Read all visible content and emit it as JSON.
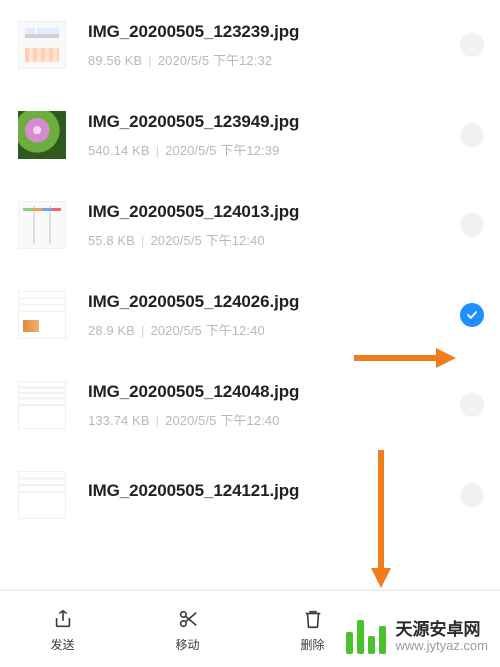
{
  "files": [
    {
      "name": "IMG_20200505_123239.jpg",
      "size": "89.56 KB",
      "date": "2020/5/5 下午12:32",
      "thumb": "screenshot",
      "selected": false
    },
    {
      "name": "IMG_20200505_123949.jpg",
      "size": "540.14 KB",
      "date": "2020/5/5 下午12:39",
      "thumb": "photo",
      "selected": false
    },
    {
      "name": "IMG_20200505_124013.jpg",
      "size": "55.8 KB",
      "date": "2020/5/5 下午12:40",
      "thumb": "diagram",
      "selected": false
    },
    {
      "name": "IMG_20200505_124026.jpg",
      "size": "28.9 KB",
      "date": "2020/5/5 下午12:40",
      "thumb": "doc1",
      "selected": true
    },
    {
      "name": "IMG_20200505_124048.jpg",
      "size": "133.74 KB",
      "date": "2020/5/5 下午12:40",
      "thumb": "doc2",
      "selected": false
    },
    {
      "name": "IMG_20200505_124121.jpg",
      "size": "",
      "date": "",
      "thumb": "doc3",
      "selected": false
    }
  ],
  "toolbar": {
    "send": "发送",
    "move": "移动",
    "delete": "删除",
    "more": ""
  },
  "watermark": {
    "title": "天源安卓网",
    "url": "www.jytyaz.com"
  },
  "colors": {
    "accent": "#1e90ff",
    "arrow": "#f07c1e",
    "brand_green": "#49c22d"
  }
}
